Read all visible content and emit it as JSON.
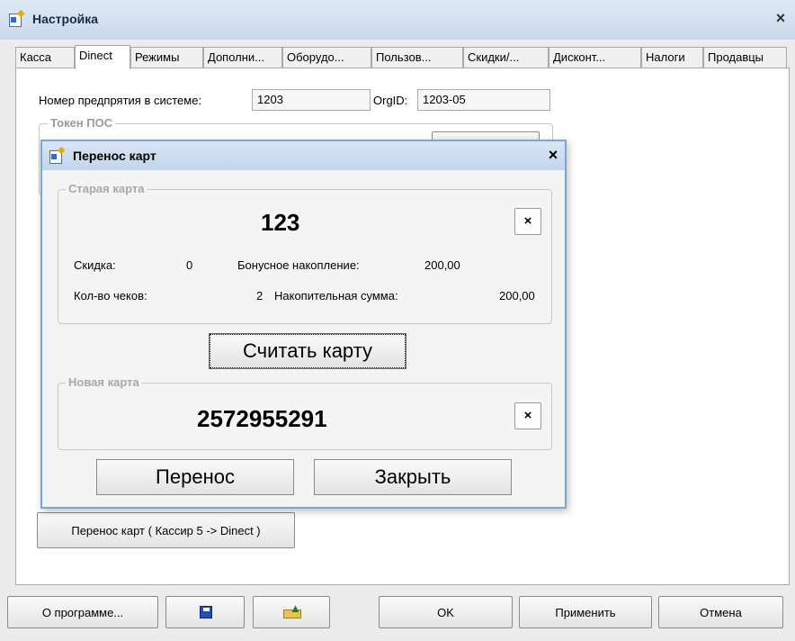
{
  "window": {
    "title": "Настройка",
    "close_glyph": "×"
  },
  "tabs": [
    {
      "label": "Касса"
    },
    {
      "label": "Dinect",
      "active": true
    },
    {
      "label": "Режимы"
    },
    {
      "label": "Дополни..."
    },
    {
      "label": "Оборудо..."
    },
    {
      "label": "Пользов..."
    },
    {
      "label": "Скидки/..."
    },
    {
      "label": "Дисконт..."
    },
    {
      "label": "Налоги"
    },
    {
      "label": "Продавцы"
    }
  ],
  "dinect": {
    "enterprise_label": "Номер предпрятия в системе:",
    "enterprise_value": "1203",
    "orgid_label": "OrgID:",
    "orgid_value": "1203-05",
    "token_group_title": "Токен ПОС",
    "transfer_button": "Перенос карт ( Кассир 5 -> Dinect )"
  },
  "dialog": {
    "title": "Перенос карт",
    "close_glyph": "×",
    "old_card": {
      "group_title": "Старая карта",
      "number": "123",
      "clear_glyph": "×",
      "discount_label": "Скидка:",
      "discount_value": "0",
      "bonus_label": "Бонусное накопление:",
      "bonus_value": "200,00",
      "checks_label": "Кол-во чеков:",
      "checks_value": "2",
      "cumulative_label": "Накопительная сумма:",
      "cumulative_value": "200,00"
    },
    "read_card_button": "Считать карту",
    "new_card": {
      "group_title": "Новая карта",
      "number": "2572955291",
      "clear_glyph": "×"
    },
    "transfer_button": "Перенос",
    "close_button": "Закрыть"
  },
  "bottom": {
    "about_button": "О программе...",
    "ok_button": "OK",
    "apply_button": "Применить",
    "cancel_button": "Отмена"
  },
  "icons": [
    "app-icon",
    "save-icon",
    "export-icon",
    "close-icon"
  ],
  "colors": {
    "titlebar": "#c9d9ec",
    "dialog_border": "#7fa6d3",
    "group_title": "#9a9a9a"
  }
}
